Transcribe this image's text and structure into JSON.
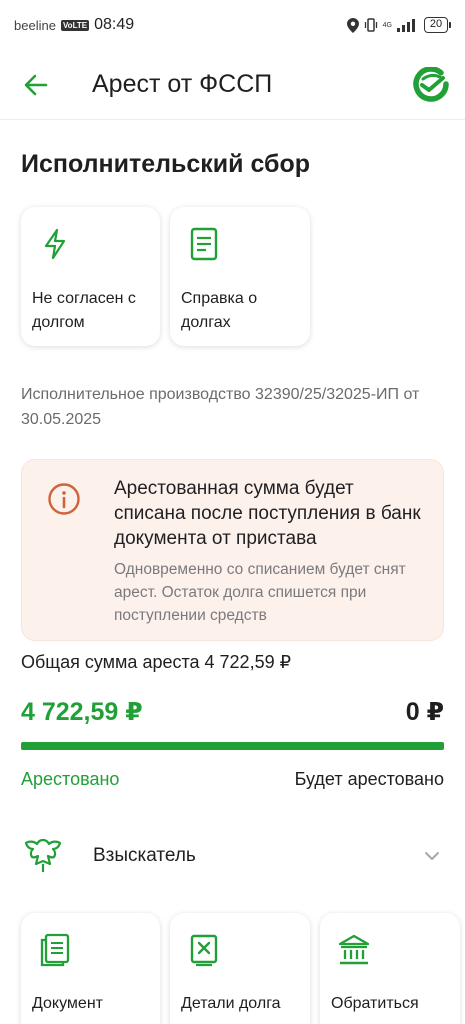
{
  "status_bar": {
    "carrier": "beeline",
    "volte": "VoLTE",
    "time": "08:49",
    "network": "4G",
    "battery": "20"
  },
  "header": {
    "title": "Арест от ФССП"
  },
  "section": {
    "title": "Исполнительский сбор"
  },
  "actions": [
    {
      "label": "Не согласен с долгом",
      "icon": "lightning-icon"
    },
    {
      "label": "Справка о долгах",
      "icon": "document-icon"
    }
  ],
  "proceeding": {
    "text": "Исполнительное производство 32390/25/32025-ИП от 30.05.2025"
  },
  "info": {
    "title": "Арестованная сумма будет списана после поступления в банк документа от пристава",
    "subtitle": "Одновременно со списанием будет снят арест. Остаток долга спишется при поступлении средств",
    "icon": "info-icon"
  },
  "arrest": {
    "total_label": "Общая сумма ареста 4 722,59 ₽",
    "arrested_amount": "4 722,59 ₽",
    "pending_amount": "0 ₽",
    "arrested_label": "Арестовано",
    "pending_label": "Будет арестовано",
    "progress_fraction": 1.0
  },
  "recoverer": {
    "label": "Взыскатель",
    "icon": "emblem-icon"
  },
  "bottom_actions": [
    {
      "label": "Документ",
      "icon": "documents-icon"
    },
    {
      "label": "Детали долга",
      "icon": "debt-details-icon"
    },
    {
      "label": "Обратиться",
      "icon": "bank-icon"
    }
  ],
  "colors": {
    "accent": "#21a038",
    "warning": "#d0633b",
    "info_bg": "#fdf1ec",
    "text": "#1f1f22",
    "muted": "#6b6b6f"
  }
}
